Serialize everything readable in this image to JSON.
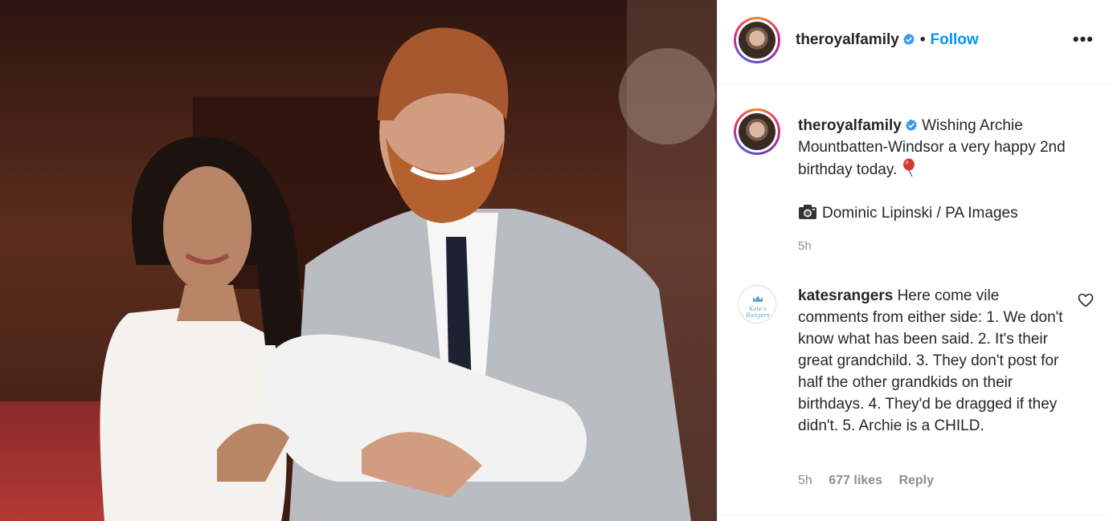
{
  "post": {
    "username": "theroyalfamily",
    "follow_label": "Follow",
    "more_label": "•••",
    "caption_lines": [
      "Wishing Archie Mountbatten-Windsor a very happy 2nd birthday today."
    ],
    "photo_credit": "Dominic Lipinski / PA Images",
    "time": "5h"
  },
  "comment": {
    "username": "katesrangers",
    "avatar_brand": "Kate's Rangers",
    "text": "Here come vile comments from either side: 1. We don't know what has been said. 2. It's their great grandchild. 3. They don't post for half the other grandkids on their birthdays. 4. They'd be dragged if they didn't. 5. Archie is a CHILD.",
    "time": "5h",
    "likes": "677 likes",
    "reply_label": "Reply"
  },
  "icons": {
    "verified": "verified-badge-icon",
    "balloon": "balloon-icon",
    "camera": "camera-icon",
    "heart": "heart-icon",
    "more": "more-options-icon"
  },
  "colors": {
    "follow": "#0095f6",
    "verified": "#3897f0",
    "muted": "#8e8e8e",
    "text": "#262626"
  }
}
